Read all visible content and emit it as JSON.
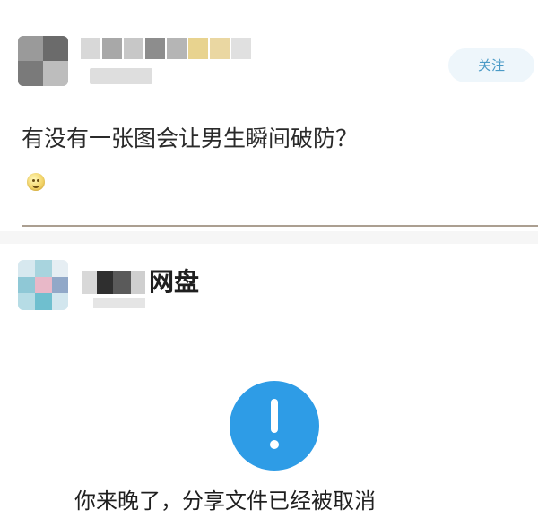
{
  "post": {
    "follow_label": "关注",
    "question": "有没有一张图会让男生瞬间破防？",
    "emoji": "smile-face"
  },
  "share": {
    "title": "网盘",
    "message": "你来晚了，分享文件已经被取消",
    "status_icon": "info-alert-icon"
  },
  "colors": {
    "accent": "#2e9ce6",
    "follow_bg": "#eef6fb",
    "follow_text": "#4a9ac6",
    "divider": "#ab9f91"
  }
}
